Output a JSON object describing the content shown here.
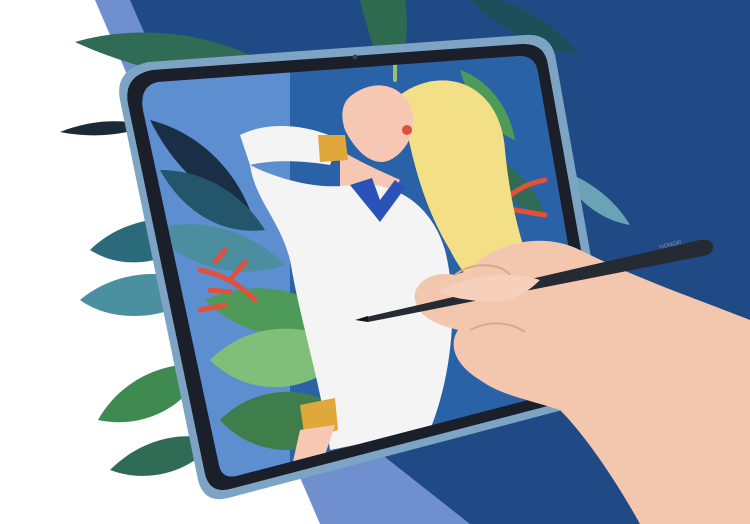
{
  "scene": {
    "subject": "tablet-with-stylus-illustration",
    "pen_brand_text": "HONOR"
  },
  "colors": {
    "background_white": "#ffffff",
    "background_light_blue": "#6f8fcf",
    "background_navy": "#1f4a86",
    "tablet_frame": "#7da4c4",
    "tablet_bezel": "#1a1f2a",
    "screen_sky": "#2a62a8",
    "leaf_dark": "#23566a",
    "leaf_green": "#4e9a59",
    "leaf_light": "#7fbf7a",
    "hair_blonde": "#f3df86",
    "shirt_white": "#f4f4f4",
    "skin_tone": "#f6c8b3",
    "collar_blue": "#2a52b8",
    "cuff_yellow": "#e0a73a",
    "red_branch": "#e0503a",
    "stylus": "#252a33"
  }
}
